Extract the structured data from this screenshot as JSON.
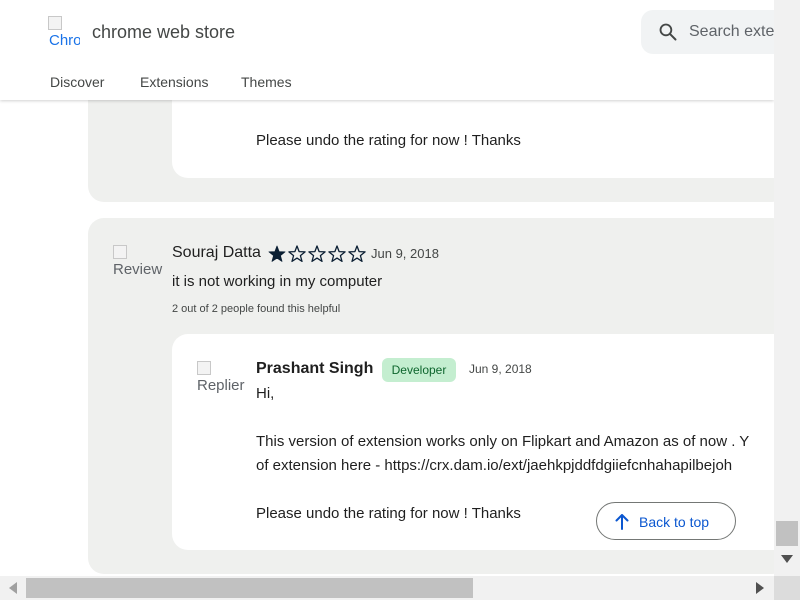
{
  "header": {
    "logo_alt": "Chro",
    "brand": "chrome web store",
    "search_placeholder": "Search exte",
    "nav": [
      "Discover",
      "Extensions",
      "Themes"
    ]
  },
  "previous_reply": {
    "body_last": "Please undo the rating for now ! Thanks"
  },
  "review": {
    "avatar_alt": "Review",
    "name": "Souraj Datta",
    "rating": 1,
    "max_rating": 5,
    "date": "Jun 9, 2018",
    "text": "it is not working in my computer",
    "helpful": "2 out of 2 people found this helpful"
  },
  "reply": {
    "avatar_alt": "Replier",
    "name": "Prashant Singh",
    "badge": "Developer",
    "date": "Jun 9, 2018",
    "line1": "Hi,",
    "line2": "This version of extension works only on Flipkart and Amazon as of now . Y",
    "line3": "of extension here - https://crx.dam.io/ext/jaehkpjddfdgiiefcnhahapilbejoh",
    "line4": "Please undo the rating for now ! Thanks"
  },
  "back_to_top": "Back to top",
  "colors": {
    "card_bg": "#eff0ee",
    "star": "#0b1f33",
    "badge_bg": "#c4eed0",
    "badge_text": "#0d652d",
    "link_blue": "#0b57d0"
  }
}
